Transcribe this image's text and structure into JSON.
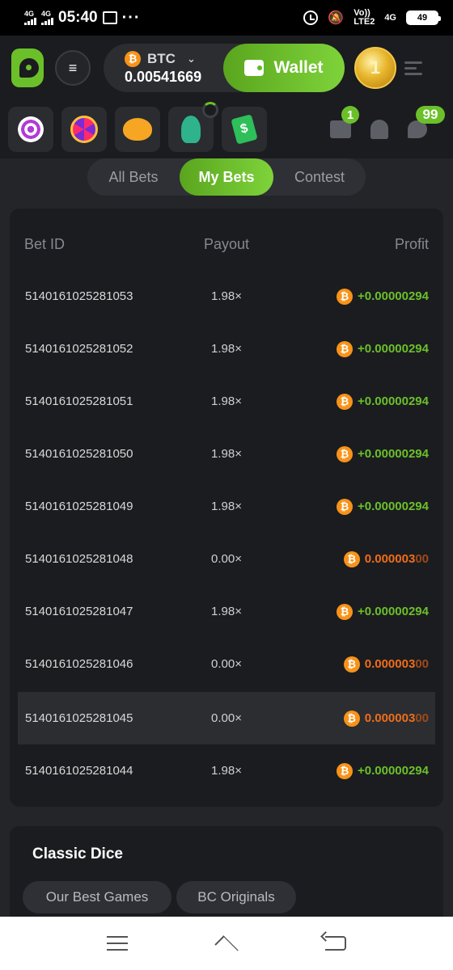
{
  "statusbar": {
    "net1": "4G",
    "net2": "4G",
    "time": "05:40",
    "more": "···",
    "volte_top": "Vo))",
    "volte_bottom": "LTE2",
    "net3": "4G",
    "battery": "49"
  },
  "header": {
    "currency": "BTC",
    "currency_icon": "bitcoin-icon",
    "balance": "0.00541669",
    "wallet_label": "Wallet",
    "avatar_letter": "1",
    "menu_glyph": "≡"
  },
  "notifications": {
    "mail_count": "1",
    "chat_count": "99"
  },
  "tabs": [
    "All Bets",
    "My Bets",
    "Contest"
  ],
  "active_tab": "My Bets",
  "table": {
    "headers": {
      "id": "Bet ID",
      "payout": "Payout",
      "profit": "Profit"
    },
    "rows": [
      {
        "id": "5140161025281053",
        "payout": "1.98×",
        "profit": "+0.00000294",
        "result": "win"
      },
      {
        "id": "5140161025281052",
        "payout": "1.98×",
        "profit": "+0.00000294",
        "result": "win"
      },
      {
        "id": "5140161025281051",
        "payout": "1.98×",
        "profit": "+0.00000294",
        "result": "win"
      },
      {
        "id": "5140161025281050",
        "payout": "1.98×",
        "profit": "+0.00000294",
        "result": "win"
      },
      {
        "id": "5140161025281049",
        "payout": "1.98×",
        "profit": "+0.00000294",
        "result": "win"
      },
      {
        "id": "5140161025281048",
        "payout": "0.00×",
        "profit_main": "0.000003",
        "profit_dim": "00",
        "result": "loss"
      },
      {
        "id": "5140161025281047",
        "payout": "1.98×",
        "profit": "+0.00000294",
        "result": "win"
      },
      {
        "id": "5140161025281046",
        "payout": "0.00×",
        "profit_main": "0.000003",
        "profit_dim": "00",
        "result": "loss"
      },
      {
        "id": "5140161025281045",
        "payout": "0.00×",
        "profit_main": "0.000003",
        "profit_dim": "00",
        "result": "loss"
      },
      {
        "id": "5140161025281044",
        "payout": "1.98×",
        "profit": "+0.00000294",
        "result": "win"
      }
    ]
  },
  "game_card": {
    "title": "Classic Dice",
    "chips": [
      "Our Best Games",
      "BC Originals"
    ]
  },
  "colors": {
    "accent_green": "#6bc02a",
    "loss_orange": "#f06d1a",
    "bitcoin": "#f7931a"
  }
}
